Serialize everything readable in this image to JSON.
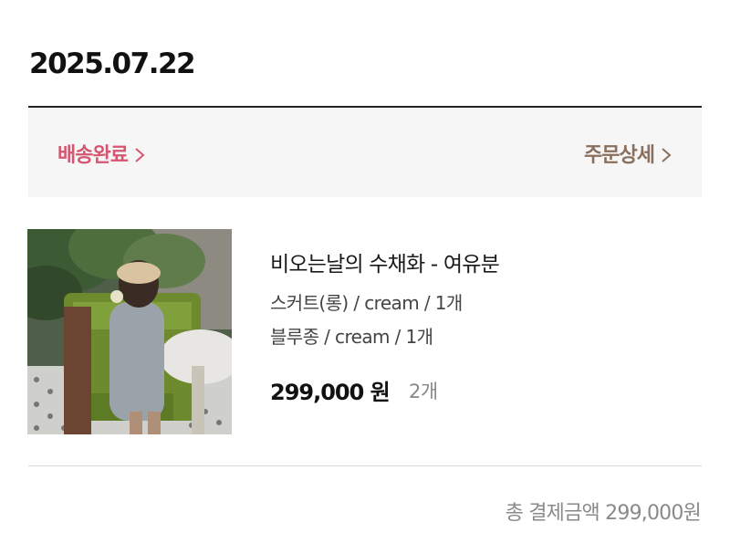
{
  "order": {
    "date": "2025.07.22"
  },
  "status": {
    "label": "배송완료",
    "detail_label": "주문상세",
    "status_color": "#d6566f",
    "detail_color": "#8a6f5c",
    "chevron_icon": "chevron-right-icon"
  },
  "item": {
    "name": "비오는날의 수채화 - 여유분",
    "options": [
      "스커트(롱) / cream / 1개",
      "블루종 / cream / 1개"
    ],
    "price": "299,000 원",
    "quantity": "2개"
  },
  "summary": {
    "total": "총 결제금액 299,000원"
  }
}
